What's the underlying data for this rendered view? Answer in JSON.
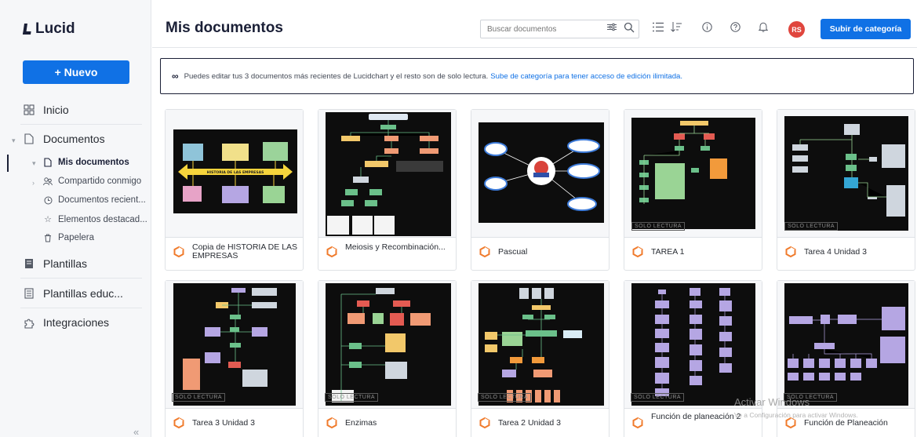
{
  "app": {
    "brand": "Lucid"
  },
  "sidebar": {
    "new_button": "+ Nuevo",
    "items": [
      {
        "label": "Inicio",
        "icon": "grid-icon"
      },
      {
        "label": "Documentos",
        "icon": "document-icon"
      },
      {
        "label": "Plantillas",
        "icon": "template-icon"
      },
      {
        "label": "Plantillas educ...",
        "icon": "template-edu-icon"
      },
      {
        "label": "Integraciones",
        "icon": "puzzle-icon"
      }
    ],
    "sub_items": [
      {
        "label": "Mis documentos",
        "icon": "document-icon"
      },
      {
        "label": "Compartido conmigo",
        "icon": "shared-icon"
      },
      {
        "label": "Documentos recient...",
        "icon": "clock-icon"
      },
      {
        "label": "Elementos destacad...",
        "icon": "star-icon"
      },
      {
        "label": "Papelera",
        "icon": "trash-icon"
      }
    ]
  },
  "header": {
    "title": "Mis documentos",
    "search_placeholder": "Buscar documentos",
    "avatar_initials": "RS",
    "upgrade_button": "Subir de categoría"
  },
  "banner": {
    "text": "Puedes editar tus 3 documentos más recientes de Lucidchart y el resto son de solo lectura.",
    "link": "Sube de categoría para tener acceso de edición ilimitada."
  },
  "read_only_label": "SOLO LECTURA",
  "documents": [
    {
      "name": "Copia de HISTORIA DE LAS EMPRESAS",
      "read_only": false
    },
    {
      "name": "Meiosis y Recombinación...",
      "read_only": false
    },
    {
      "name": "Pascual",
      "read_only": false
    },
    {
      "name": "TAREA 1",
      "read_only": true
    },
    {
      "name": "Tarea 4 Unidad 3",
      "read_only": true
    },
    {
      "name": "Tarea 3 Unidad 3",
      "read_only": true
    },
    {
      "name": "Enzimas",
      "read_only": true
    },
    {
      "name": "Tarea 2 Unidad 3",
      "read_only": true
    },
    {
      "name": "Función de planeación 2",
      "read_only": true
    },
    {
      "name": "Función de Planeación",
      "read_only": true
    }
  ],
  "watermark": {
    "title": "Activar Windows",
    "subtitle": "Ve a Configuración para activar Windows."
  },
  "colors": {
    "accent": "#1071e5",
    "avatar": "#e0463e",
    "doc_icon": "#f07b2c"
  }
}
